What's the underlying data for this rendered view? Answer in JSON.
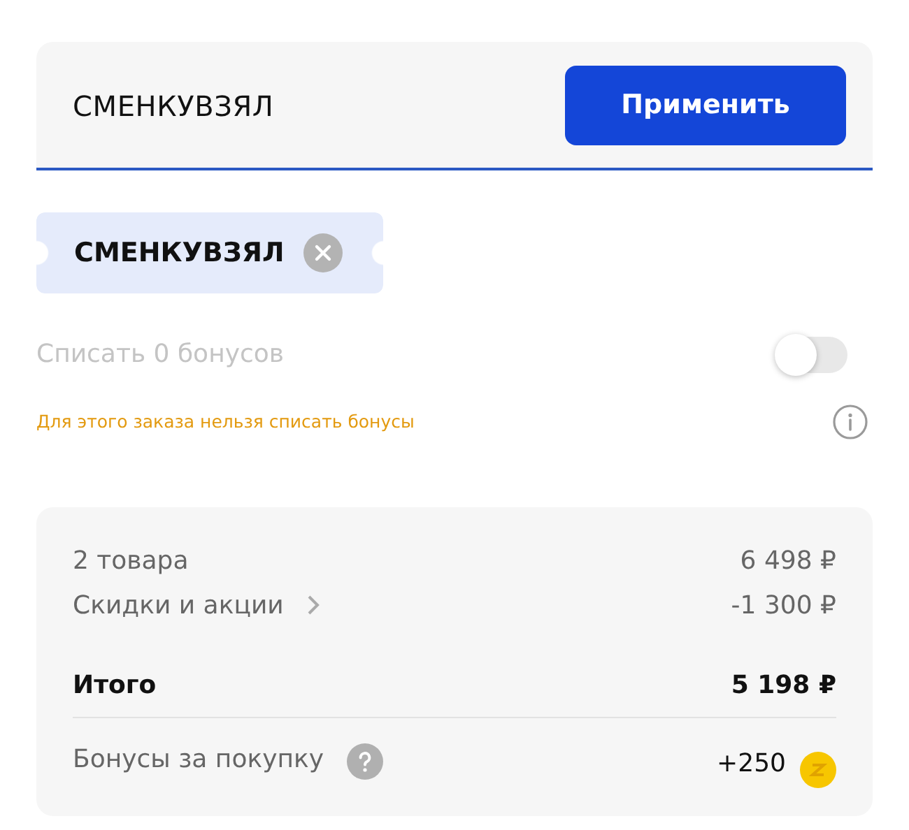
{
  "promo": {
    "value": "СМЕНКУВЗЯЛ",
    "focused": true,
    "button": "Применить"
  },
  "coupon": {
    "code": "СМЕНКУВЗЯЛ"
  },
  "bonus_toggle": {
    "label": "Списать 0 бонусов",
    "on": false,
    "disabled": true
  },
  "warning": "Для этого заказа нельзя списать бонусы",
  "summary": [
    {
      "kind": "line",
      "label": "2 товара",
      "value": "6 498 ₽"
    },
    {
      "kind": "link",
      "label": "Скидки и акции",
      "value": "-1 300 ₽"
    },
    {
      "kind": "total",
      "label": "Итого",
      "value": "5 198 ₽"
    },
    {
      "kind": "bonus",
      "label": "Бонусы за покупку",
      "value": "+250"
    }
  ]
}
